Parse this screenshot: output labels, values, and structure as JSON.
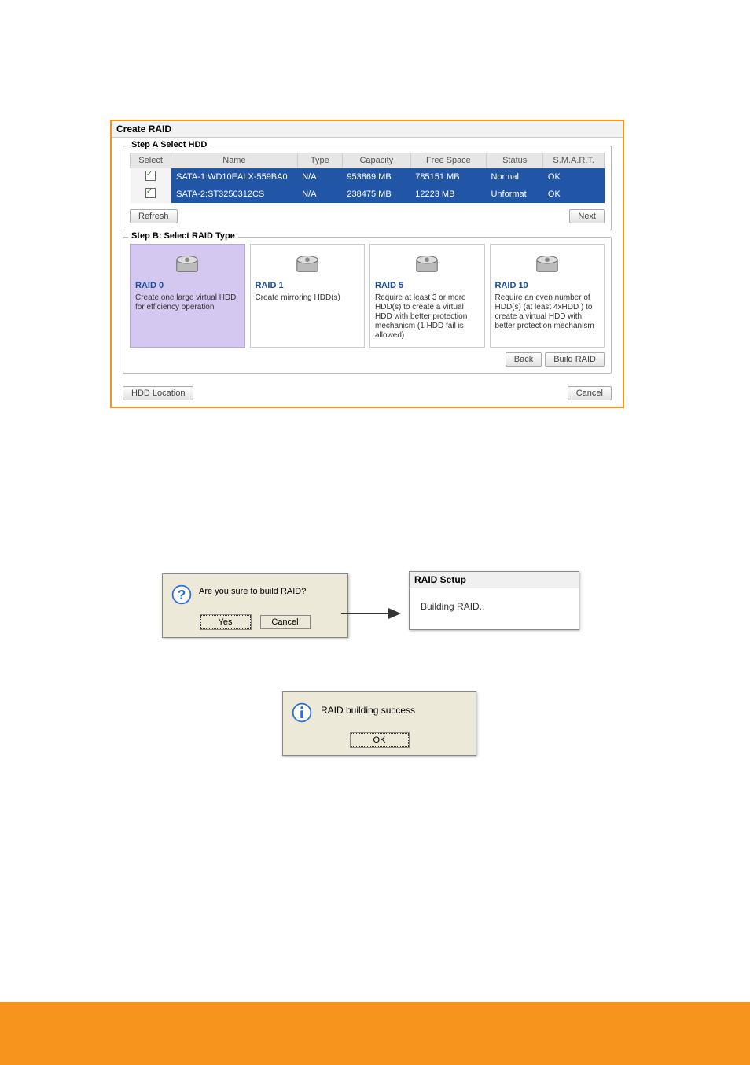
{
  "create_raid": {
    "window_title": "Create RAID",
    "step_a": {
      "title": "Step A Select HDD",
      "columns": [
        "Select",
        "Name",
        "Type",
        "Capacity",
        "Free Space",
        "Status",
        "S.M.A.R.T."
      ],
      "rows": [
        {
          "checked": true,
          "name": "SATA-1:WD10EALX-559BA0",
          "type": "N/A",
          "capacity": "953869 MB",
          "free": "785151 MB",
          "status": "Normal",
          "smart": "OK"
        },
        {
          "checked": true,
          "name": "SATA-2:ST3250312CS",
          "type": "N/A",
          "capacity": "238475 MB",
          "free": "12223 MB",
          "status": "Unformat",
          "smart": "OK"
        }
      ],
      "refresh_label": "Refresh",
      "next_label": "Next"
    },
    "step_b": {
      "title": "Step B: Select RAID Type",
      "cards": [
        {
          "title": "RAID 0",
          "desc": "Create one large virtual HDD for efficiency operation",
          "selected": true
        },
        {
          "title": "RAID 1",
          "desc": "Create mirroring HDD(s)",
          "selected": false
        },
        {
          "title": "RAID 5",
          "desc": "Require at least 3 or more HDD(s)  to create a virtual HDD with better protection mechanism (1 HDD fail is allowed)",
          "selected": false
        },
        {
          "title": "RAID 10",
          "desc": "Require an even number of HDD(s) (at least 4xHDD ) to create a virtual HDD with better protection mechanism",
          "selected": false
        }
      ],
      "back_label": "Back",
      "build_label": "Build RAID"
    },
    "hdd_location_label": "HDD Location",
    "cancel_label": "Cancel"
  },
  "confirm": {
    "message": "Are you sure to build RAID?",
    "yes_label": "Yes",
    "cancel_label": "Cancel"
  },
  "raid_setup": {
    "title": "RAID Setup",
    "message": "Building RAID.."
  },
  "success": {
    "message": "RAID building success",
    "ok_label": "OK"
  }
}
